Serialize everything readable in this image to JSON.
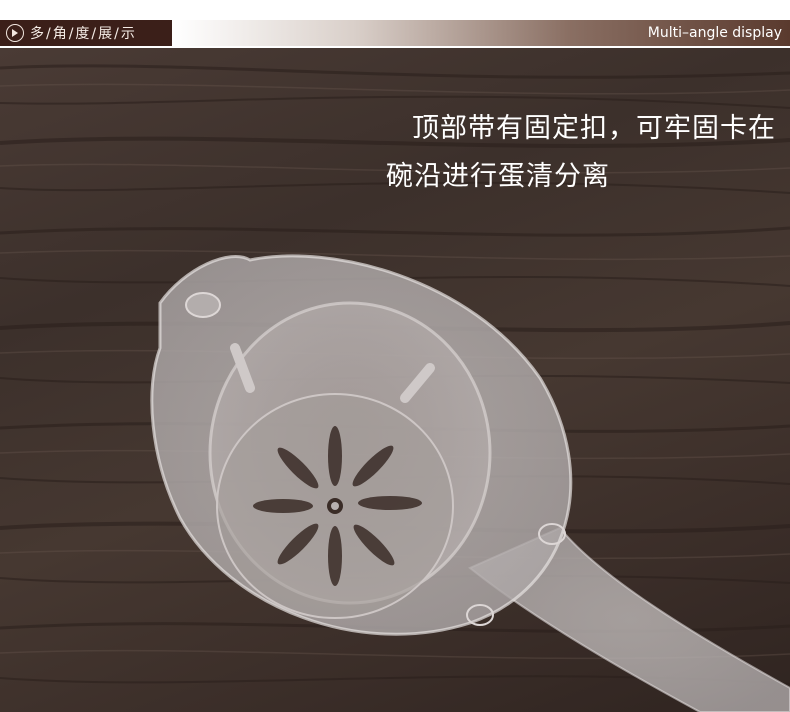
{
  "header": {
    "title_cn": "多/角/度/展/示",
    "title_en": "Multi–angle display"
  },
  "caption": {
    "line1": "顶部带有固定扣，可牢固卡在",
    "line2": "碗沿进行蛋清分离"
  },
  "icons": {
    "section_marker": "play-circle-icon"
  },
  "colors": {
    "header_dark": "#3b1f19",
    "wood_dark": "#3a2e2a",
    "caption_text": "#ffffff"
  }
}
